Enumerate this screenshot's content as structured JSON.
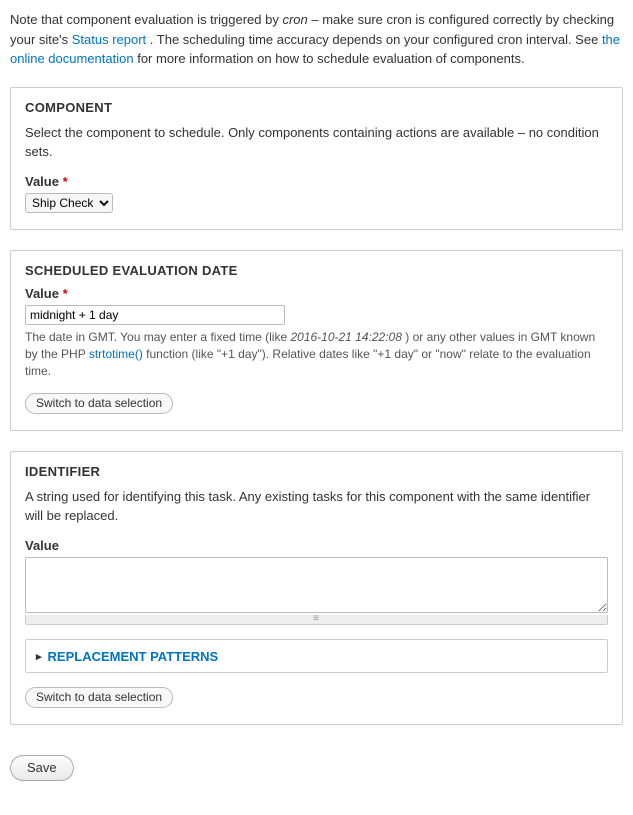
{
  "intro": {
    "prefix": "Note that component evaluation is triggered by ",
    "cron_word": "cron",
    "after_cron": " – make sure cron is configured correctly by checking your site's ",
    "link1": "Status report",
    "after_link1": ". The scheduling time accuracy depends on your configured cron interval. See ",
    "link2": "the online documentation",
    "after_link2": " for more information on how to schedule evaluation of components."
  },
  "component": {
    "title": "COMPONENT",
    "description": "Select the component to schedule. Only components containing actions are available – no condition sets.",
    "value_label": "Value",
    "required_mark": "*",
    "selected": "Ship Check"
  },
  "scheduled": {
    "title": "SCHEDULED EVALUATION DATE",
    "value_label": "Value",
    "required_mark": "*",
    "input_value": "midnight + 1 day",
    "help_prefix": "The date in GMT. You may enter a fixed time (like ",
    "help_example": "2016-10-21 14:22:08",
    "help_mid": ") or any other values in GMT known by the PHP ",
    "help_link": "strtotime()",
    "help_suffix": " function (like \"+1 day\"). Relative dates like \"+1 day\" or \"now\" relate to the evaluation time.",
    "switch_btn": "Switch to data selection"
  },
  "identifier": {
    "title": "IDENTIFIER",
    "description": "A string used for identifying this task. Any existing tasks for this component with the same identifier will be replaced.",
    "value_label": "Value",
    "textarea_value": "",
    "patterns_label": "REPLACEMENT PATTERNS",
    "switch_btn": "Switch to data selection"
  },
  "save_label": "Save"
}
